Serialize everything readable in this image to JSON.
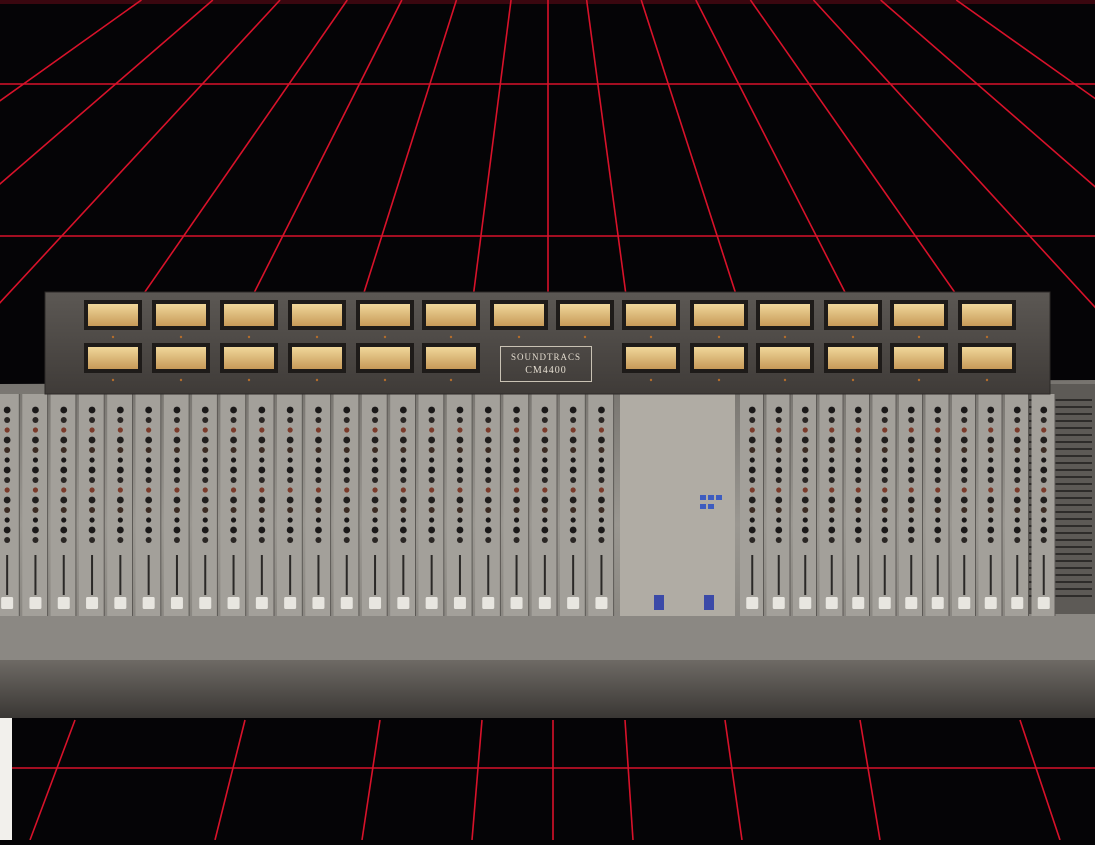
{
  "brand": {
    "name": "SOUNDTRACS",
    "model": "CM4400"
  },
  "colors": {
    "background": "#050406",
    "grid": "#d8122a",
    "bridge": "#4e4a47",
    "meter_face": "#d9b878",
    "console_body": "#8c8984",
    "fader_cap": "#e8e6e0"
  }
}
